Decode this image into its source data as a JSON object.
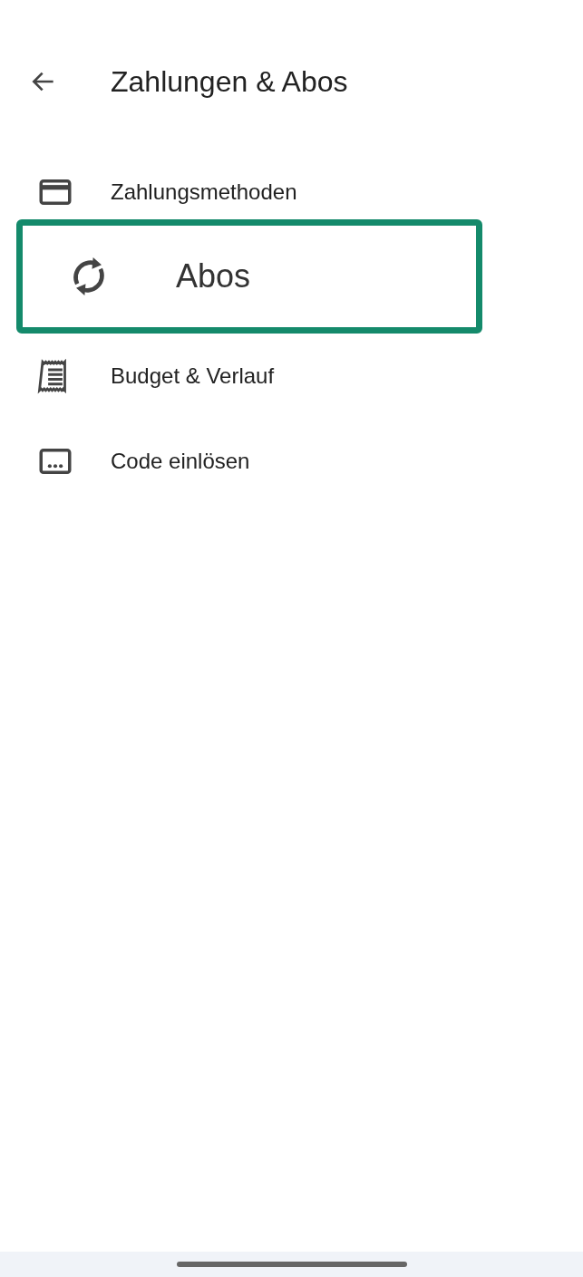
{
  "header": {
    "title": "Zahlungen & Abos"
  },
  "items": [
    {
      "kind": "card",
      "label": "Zahlungsmethoden",
      "highlighted": false
    },
    {
      "kind": "refresh",
      "label": "Abos",
      "highlighted": true
    },
    {
      "kind": "receipt",
      "label": "Budget & Verlauf",
      "highlighted": false
    },
    {
      "kind": "code",
      "label": "Code einlösen",
      "highlighted": false
    }
  ]
}
